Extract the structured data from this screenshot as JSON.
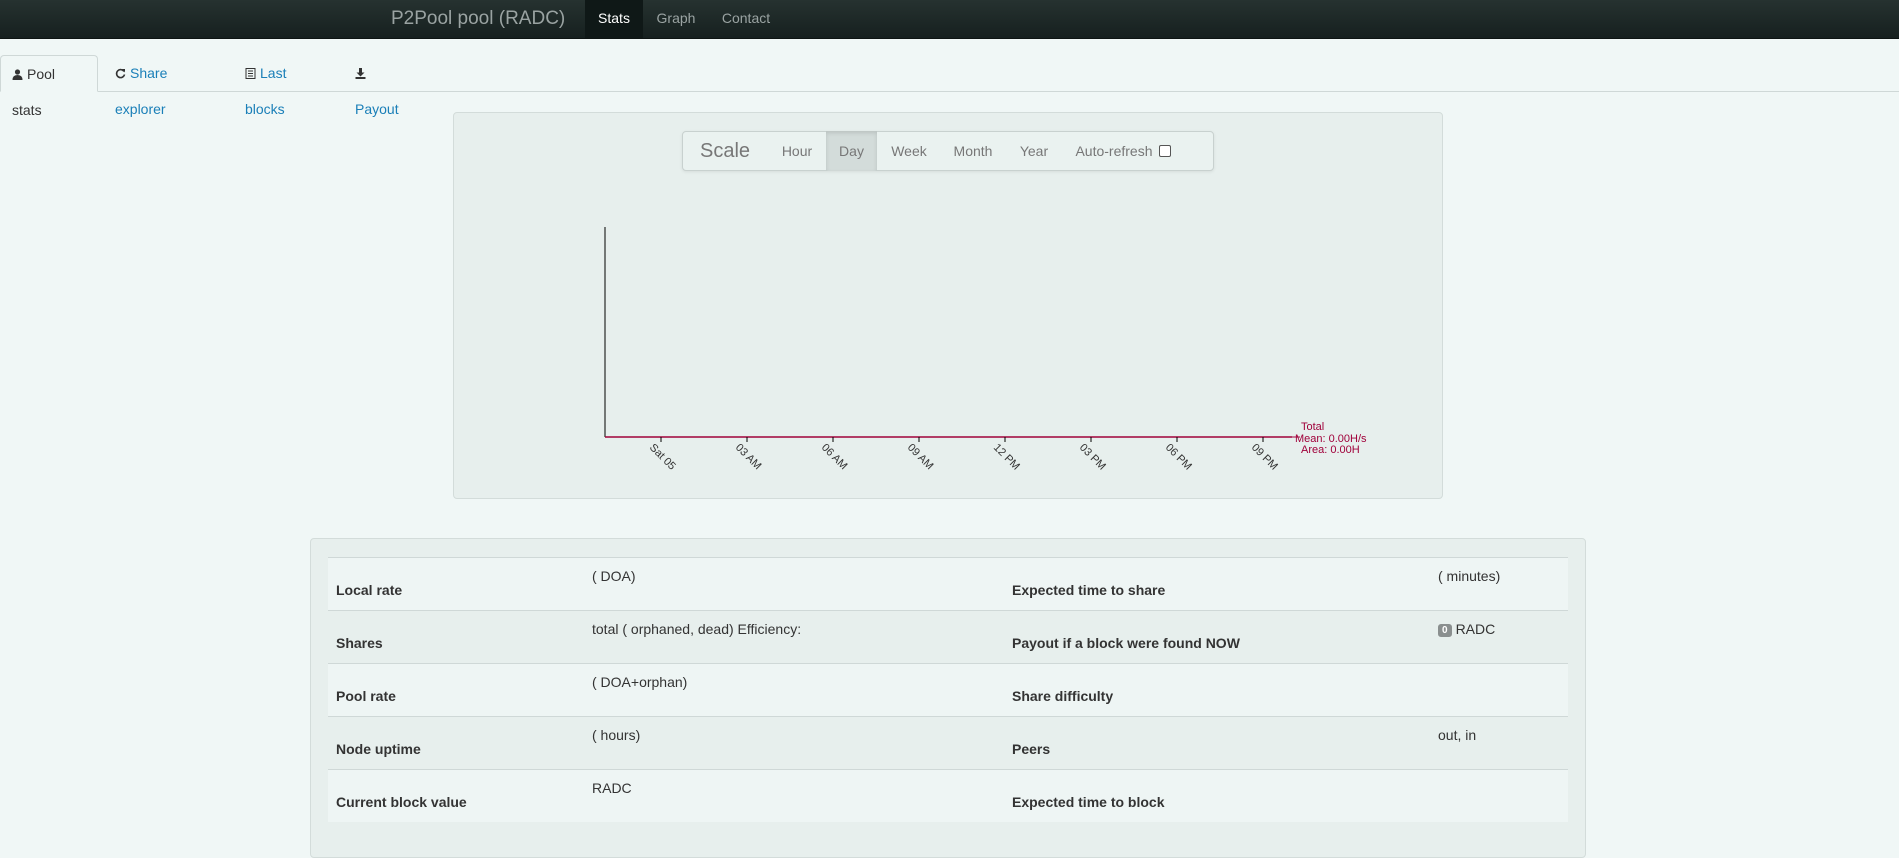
{
  "navbar": {
    "brand": "P2Pool pool (RADC)",
    "links": [
      {
        "label": "Stats",
        "active": true
      },
      {
        "label": "Graph",
        "active": false
      },
      {
        "label": "Contact",
        "active": false
      }
    ]
  },
  "tabs": [
    {
      "label": "Pool stats",
      "icon": "user-icon",
      "active": true
    },
    {
      "label": "Share explorer",
      "icon": "refresh-icon",
      "active": false
    },
    {
      "label": "Last blocks",
      "icon": "list-icon",
      "active": false
    },
    {
      "label": "Payout",
      "icon": "download-icon",
      "active": false
    }
  ],
  "scale": {
    "title": "Scale",
    "buttons": [
      {
        "label": "Hour",
        "active": false
      },
      {
        "label": "Day",
        "active": true
      },
      {
        "label": "Week",
        "active": false
      },
      {
        "label": "Month",
        "active": false
      },
      {
        "label": "Year",
        "active": false
      }
    ],
    "auto_refresh_label": "Auto-refresh",
    "auto_refresh_checked": false
  },
  "chart_data": {
    "type": "area",
    "x_tick_labels": [
      "Sat 05",
      "03 AM",
      "06 AM",
      "09 AM",
      "12 PM",
      "03 PM",
      "06 PM",
      "09 PM"
    ],
    "series": [
      {
        "name": "Total",
        "values": [
          0,
          0,
          0,
          0,
          0,
          0,
          0,
          0
        ]
      }
    ],
    "legend": {
      "title": "Total",
      "mean": "Mean: 0.00H/s",
      "area": "Area: 0.00H",
      "placement": "right"
    },
    "series_color": "#a0003a",
    "axis_color": "#000000"
  },
  "stats": {
    "rows": [
      {
        "left_label": "Local rate",
        "left_value": "( DOA)",
        "right_label": "Expected time to share",
        "right_value": "( minutes)",
        "right_badge": ""
      },
      {
        "left_label": "Shares",
        "left_value": "total ( orphaned, dead) Efficiency:",
        "right_label": "Payout if a block were found NOW",
        "right_value": "RADC",
        "right_badge": "0"
      },
      {
        "left_label": "Pool rate",
        "left_value": "( DOA+orphan)",
        "right_label": "Share difficulty",
        "right_value": "",
        "right_badge": ""
      },
      {
        "left_label": "Node uptime",
        "left_value": "( hours)",
        "right_label": "Peers",
        "right_value": "out, in",
        "right_badge": ""
      },
      {
        "left_label": "Current block value",
        "left_value": "RADC",
        "right_label": "Expected time to block",
        "right_value": "",
        "right_badge": ""
      }
    ]
  }
}
